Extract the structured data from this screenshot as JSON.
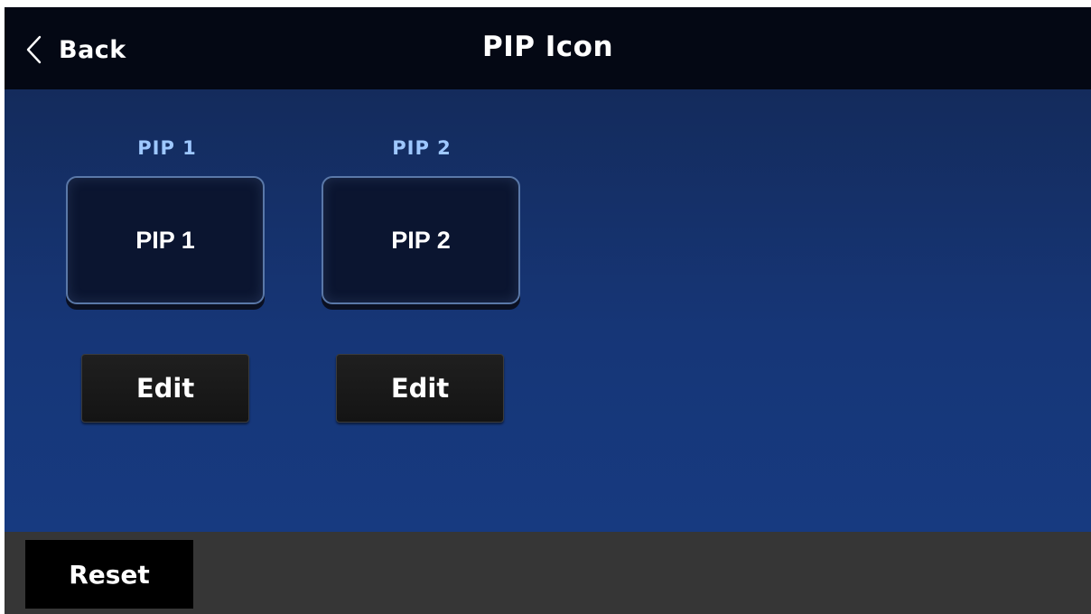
{
  "header": {
    "back_label": "Back",
    "back_icon": "chevron-left-icon",
    "title": "PIP Icon"
  },
  "pips": [
    {
      "label": "PIP 1",
      "tile_text": "PIP 1",
      "edit_label": "Edit"
    },
    {
      "label": "PIP 2",
      "tile_text": "PIP 2",
      "edit_label": "Edit"
    }
  ],
  "footer": {
    "reset_label": "Reset"
  },
  "colors": {
    "header_bg": "#040814",
    "content_bg": "#163677",
    "label_accent": "#9ec8ff",
    "footer_bg": "#363636"
  }
}
